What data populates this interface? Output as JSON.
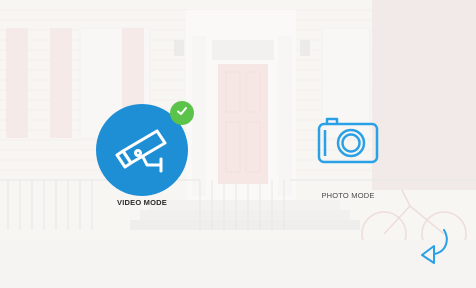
{
  "modes": {
    "video": {
      "label": "VIDEO MODE",
      "selected": true,
      "icon": "video-camera-icon"
    },
    "photo": {
      "label": "PHOTO MODE",
      "selected": false,
      "icon": "photo-camera-icon"
    }
  },
  "icons": {
    "check": "check-icon",
    "back": "back-arrow-icon"
  },
  "colors": {
    "accent": "#1e8fd5",
    "check": "#5cc34a",
    "icon_outline": "#2aa1e6",
    "back_arrow": "#2aa1e6"
  }
}
